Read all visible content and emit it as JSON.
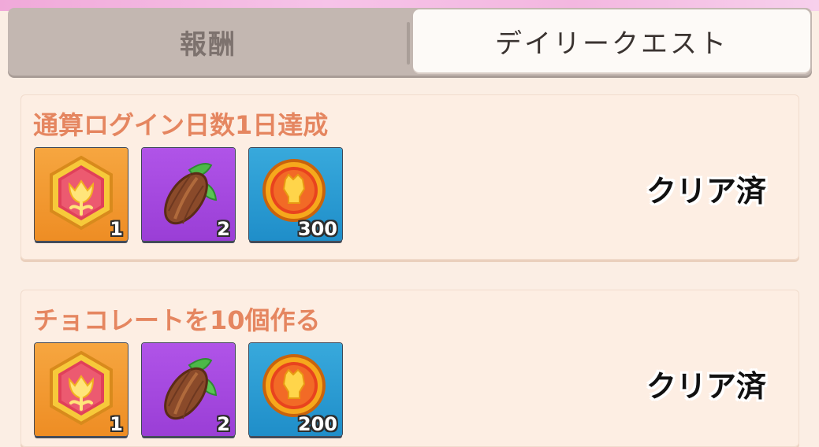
{
  "tabs": [
    {
      "label": "報酬",
      "active": false
    },
    {
      "label": "デイリークエスト",
      "active": true
    }
  ],
  "quests": [
    {
      "title": "通算ログイン日数1日達成",
      "status": "クリア済",
      "rewards": [
        {
          "icon": "tulip-badge-icon",
          "color": "#f29a30",
          "quantity": "1"
        },
        {
          "icon": "cacao-pod-icon",
          "color": "#a648e0",
          "quantity": "2"
        },
        {
          "icon": "gold-coin-icon",
          "color": "#2c9fd4",
          "quantity": "300"
        }
      ]
    },
    {
      "title": "チョコレートを10個作る",
      "status": "クリア済",
      "rewards": [
        {
          "icon": "tulip-badge-icon",
          "color": "#f29a30",
          "quantity": "1"
        },
        {
          "icon": "cacao-pod-icon",
          "color": "#a648e0",
          "quantity": "2"
        },
        {
          "icon": "gold-coin-icon",
          "color": "#2c9fd4",
          "quantity": "200"
        }
      ]
    }
  ]
}
